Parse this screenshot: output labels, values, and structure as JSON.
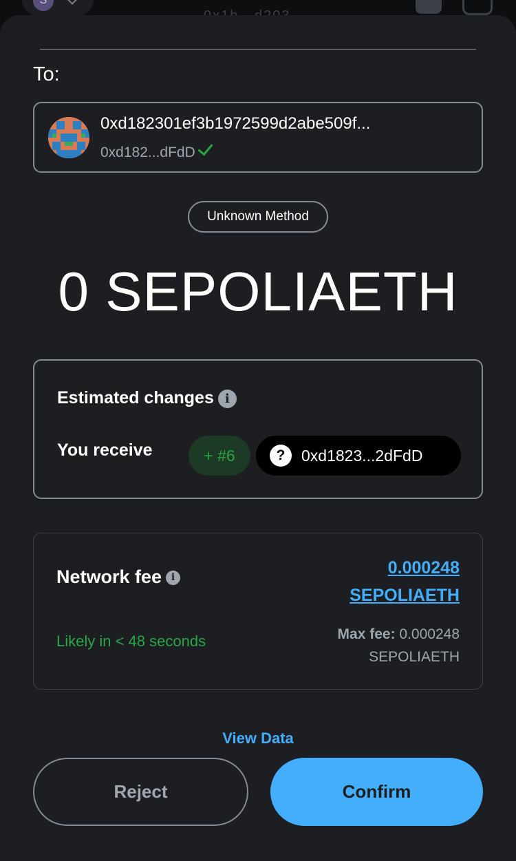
{
  "topbar": {
    "account_initial": "S",
    "network_text": "0x1b...d203"
  },
  "recipient": {
    "label": "To:",
    "address_full": "0xd182301ef3b1972599d2abe509f...",
    "address_short": "0xd182...dFdD"
  },
  "method": {
    "label": "Unknown Method"
  },
  "amount": {
    "value": "0 SEPOLIAETH"
  },
  "estimated_changes": {
    "title": "Estimated changes",
    "receive_label": "You receive",
    "nft_badge": "+ #6",
    "token_label": "0xd1823...2dFdD"
  },
  "network_fee": {
    "title": "Network fee",
    "amount_line1": "0.000248",
    "amount_line2": "SEPOLIAETH",
    "likely_text": "Likely in < 48 seconds",
    "max_fee_label": "Max fee:",
    "max_fee_value": "0.000248",
    "max_fee_unit": "SEPOLIAETH"
  },
  "view_data_label": "View Data",
  "actions": {
    "reject_label": "Reject",
    "confirm_label": "Confirm"
  },
  "colors": {
    "background": "#1c1e22",
    "accent": "#43aefc",
    "success": "#28a745",
    "muted": "#9fa6ae",
    "border": "#858b93"
  }
}
